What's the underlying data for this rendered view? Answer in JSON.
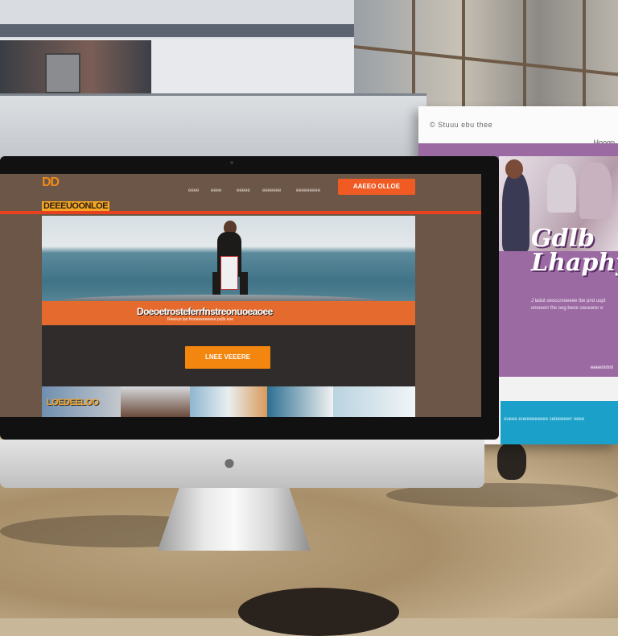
{
  "background": {
    "panel": {
      "logo": "© Stuuu ebu thee",
      "nav": "Hoogp",
      "heading": "Gdlb Lhaphy",
      "body": "J ladut oeoccrooeeee tbe pnd uupt omeeerr lhe oog beoe oeueerer e",
      "link": "eeeemmm",
      "footer": "oueee eoeeeeeeeee ceieeeeerr oeee"
    }
  },
  "imac": {
    "brand_icon": "apple-icon",
    "site": {
      "logo_mark": "DD",
      "logo": "DEEEUOONLOE",
      "nav": [
        "eeee",
        "eeee",
        "eeeee",
        "eeeeeee",
        "eeeeeeeee"
      ],
      "top_cta": "AAEEO OLLOE",
      "hero": {
        "title": "Doeoetrosteferrfnstreonuoeaoee",
        "subtitle": "Reeeuo lan frooeeeeeeeee pulls eoe"
      },
      "main_cta": "LNEE VEEERE",
      "thumbnail_label": "LOEDEELOO"
    }
  },
  "colors": {
    "accent_orange": "#f05a23",
    "cta_orange": "#f2860f",
    "site_brown": "#6b5647",
    "panel_purple": "#9b6aa3",
    "panel_teal": "#1aa0c9"
  }
}
